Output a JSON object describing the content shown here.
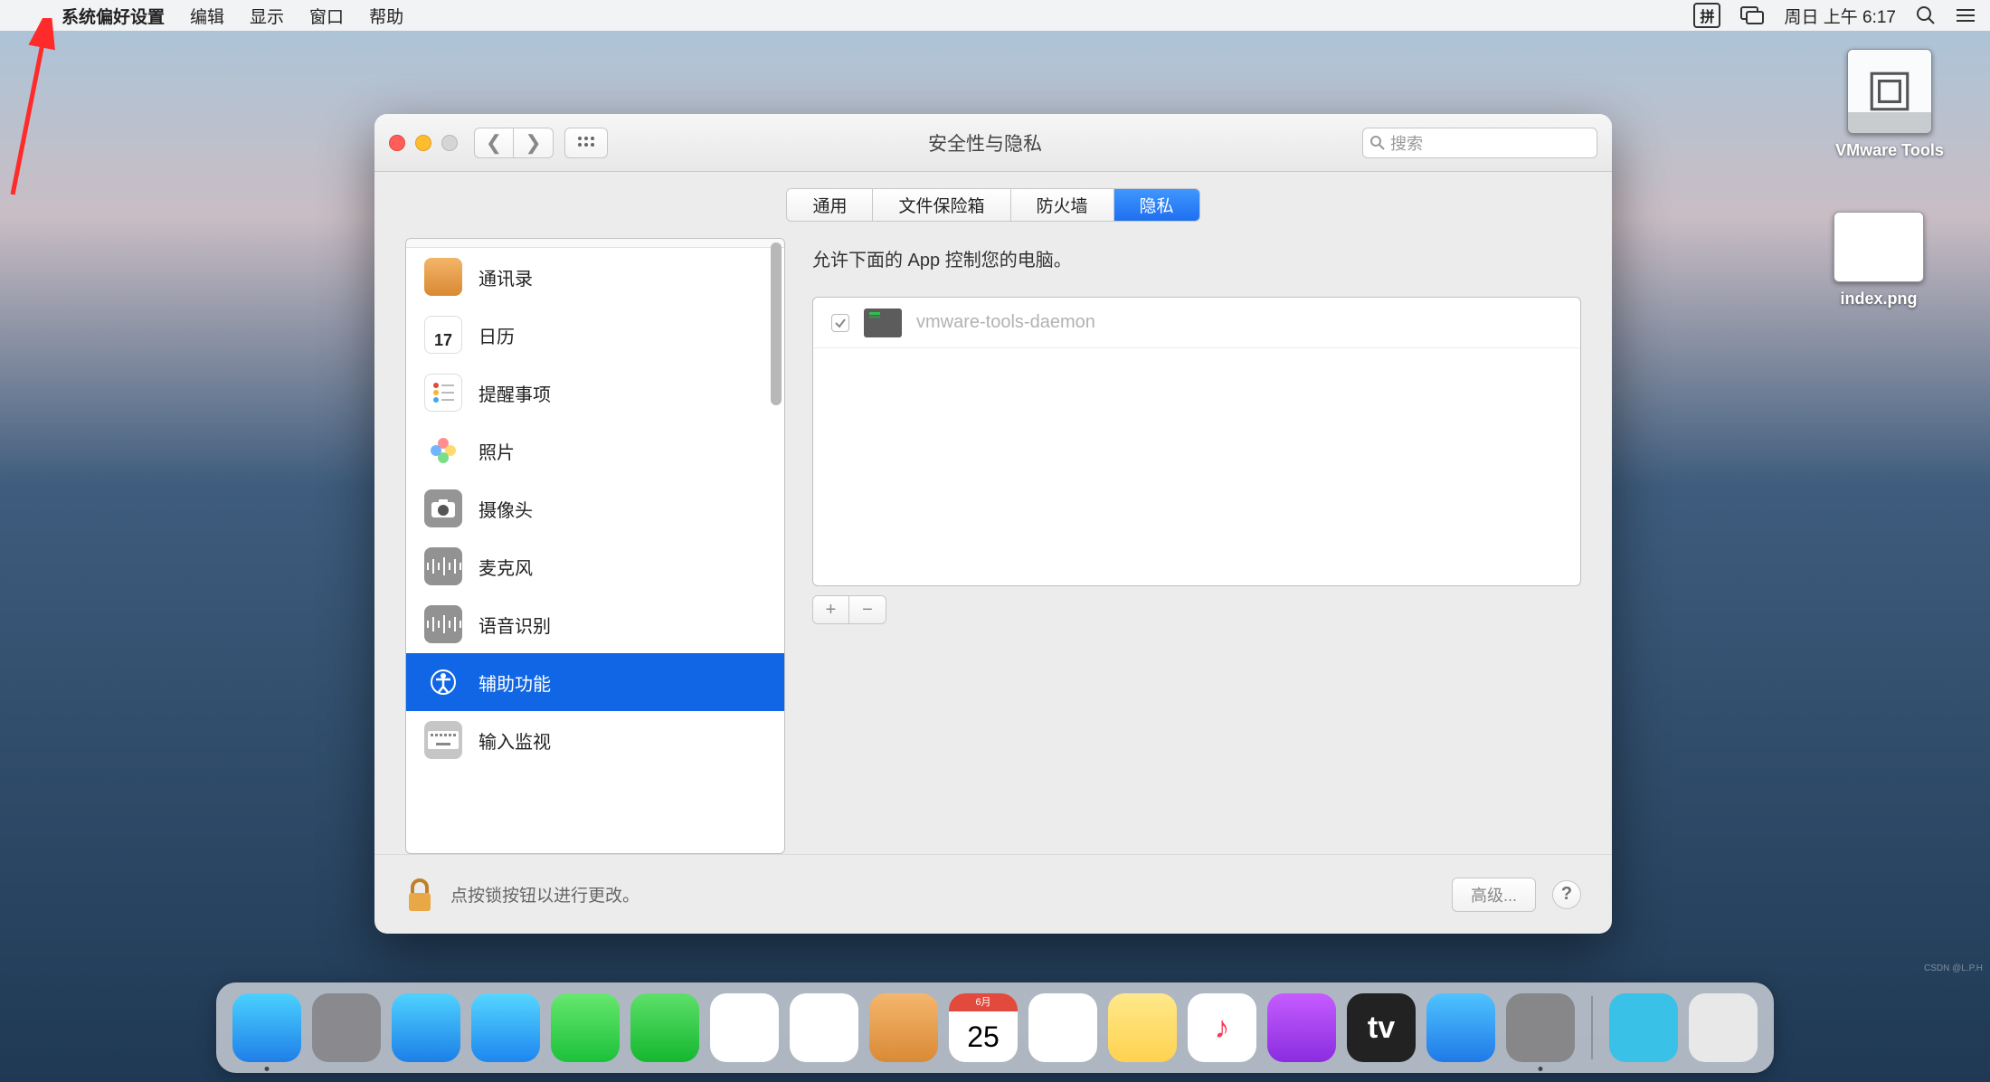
{
  "menubar": {
    "app": "系统偏好设置",
    "items": [
      "编辑",
      "显示",
      "窗口",
      "帮助"
    ],
    "ime": "拼",
    "datetime": "周日 上午 6:17"
  },
  "desktop": {
    "vmware": "VMware Tools",
    "index": "index.png"
  },
  "window": {
    "title": "安全性与隐私",
    "search_placeholder": "搜索",
    "tabs": [
      "通用",
      "文件保险箱",
      "防火墙",
      "隐私"
    ],
    "active_tab": 3
  },
  "sidebar": {
    "items": [
      {
        "label": "通讯录"
      },
      {
        "label": "日历",
        "cal_day": "17"
      },
      {
        "label": "提醒事项"
      },
      {
        "label": "照片"
      },
      {
        "label": "摄像头"
      },
      {
        "label": "麦克风"
      },
      {
        "label": "语音识别"
      },
      {
        "label": "辅助功能"
      },
      {
        "label": "输入监视"
      }
    ],
    "selected": 7
  },
  "right_panel": {
    "title": "允许下面的 App 控制您的电脑。",
    "apps": [
      {
        "name": "vmware-tools-daemon",
        "checked": true
      }
    ]
  },
  "footer": {
    "lock_text": "点按锁按钮以进行更改。",
    "advanced": "高级..."
  },
  "dock": {
    "items": [
      {
        "name": "finder",
        "bg": "linear-gradient(#4bd1ff,#1f7fe8)",
        "dot": true
      },
      {
        "name": "launchpad",
        "bg": "#8a8a8e"
      },
      {
        "name": "safari",
        "bg": "linear-gradient(#4ed2ff,#1c7fe8)"
      },
      {
        "name": "mail",
        "bg": "linear-gradient(#55d6ff,#1d86ef)"
      },
      {
        "name": "facetime",
        "bg": "linear-gradient(#66e86e,#1cc13a)"
      },
      {
        "name": "messages",
        "bg": "linear-gradient(#5de06a,#15b72f)"
      },
      {
        "name": "maps",
        "bg": "#fff"
      },
      {
        "name": "photos",
        "bg": "#fff"
      },
      {
        "name": "contacts",
        "bg": "linear-gradient(#f4b66d,#da8a36)"
      },
      {
        "name": "calendar",
        "bg": "#fff",
        "text": "25",
        "bar": "#e14a3c",
        "sub": "6月"
      },
      {
        "name": "reminders",
        "bg": "#fff"
      },
      {
        "name": "notes",
        "bg": "linear-gradient(#ffe88a,#ffd250)"
      },
      {
        "name": "music",
        "bg": "#fff",
        "glyph": "♪",
        "gc": "#fa3855"
      },
      {
        "name": "podcasts",
        "bg": "linear-gradient(#c65cff,#8a2de0)"
      },
      {
        "name": "tv",
        "bg": "#222",
        "glyph": "tv",
        "gc": "#fff"
      },
      {
        "name": "appstore",
        "bg": "linear-gradient(#4fc3ff,#1f7ae8)"
      },
      {
        "name": "settings",
        "bg": "#87878a",
        "dot": true
      }
    ],
    "right": [
      {
        "name": "downloads",
        "bg": "#3ac1e8"
      },
      {
        "name": "trash",
        "bg": "#e8e8e8"
      }
    ]
  },
  "watermark": "CSDN @L.P.H"
}
